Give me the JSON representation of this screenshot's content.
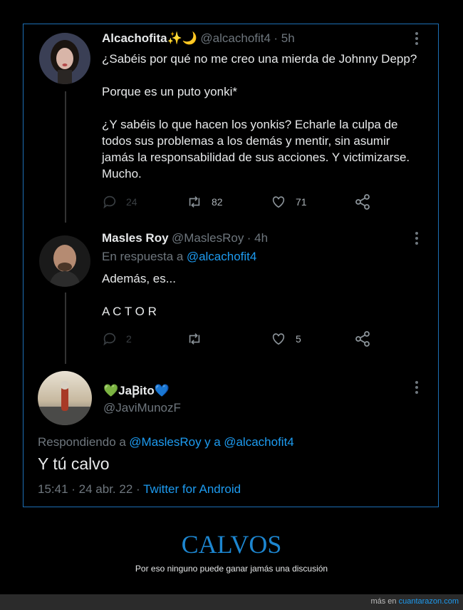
{
  "tweet1": {
    "name": "Alcachofita✨🌙",
    "handle": "@alcachofit4",
    "time": "· 5h",
    "lines1": [
      "¿Sabéis por qué no me creo una mierda de Johnny Depp?"
    ],
    "lines2": [
      "Porque es un puto yonki*"
    ],
    "lines3": [
      "¿Y sabéis lo que hacen los yonkis? Echarle la culpa de",
      "todos sus problemas a los demás y mentir, sin asumir",
      "jamás la responsabilidad de sus acciones. Y victimizarse.",
      "Mucho."
    ],
    "replies": "24",
    "retweets": "82",
    "likes": "71"
  },
  "tweet2": {
    "name": "Masles Roy",
    "handle": "@MaslesRoy",
    "time": "· 4h",
    "reply_prefix": "En respuesta a",
    "reply_to": "@alcachofit4",
    "line1": "Además, es...",
    "line2": "A C T O R",
    "replies": "2",
    "likes": "5"
  },
  "tweet3": {
    "name": "💚JaꞴito💙",
    "handle": "@JaviMunozF",
    "replying_prefix": "Respondiendo a",
    "replying_user1": "@MaslesRoy",
    "replying_and": "y a",
    "replying_user2": "@alcachofit4",
    "text": "Y tú calvo",
    "timestamp": "15:41 · 24 abr. 22 ·",
    "client": "Twitter for Android"
  },
  "footer": {
    "title": "CALVOS",
    "subtitle": "Por eso ninguno puede ganar jamás una discusión",
    "credit_prefix": "más en",
    "credit_site": "cuantarazon.com"
  },
  "colors": {
    "accent": "#1d9bf0",
    "frame": "#1d6fb5",
    "muted": "#6e767d"
  }
}
